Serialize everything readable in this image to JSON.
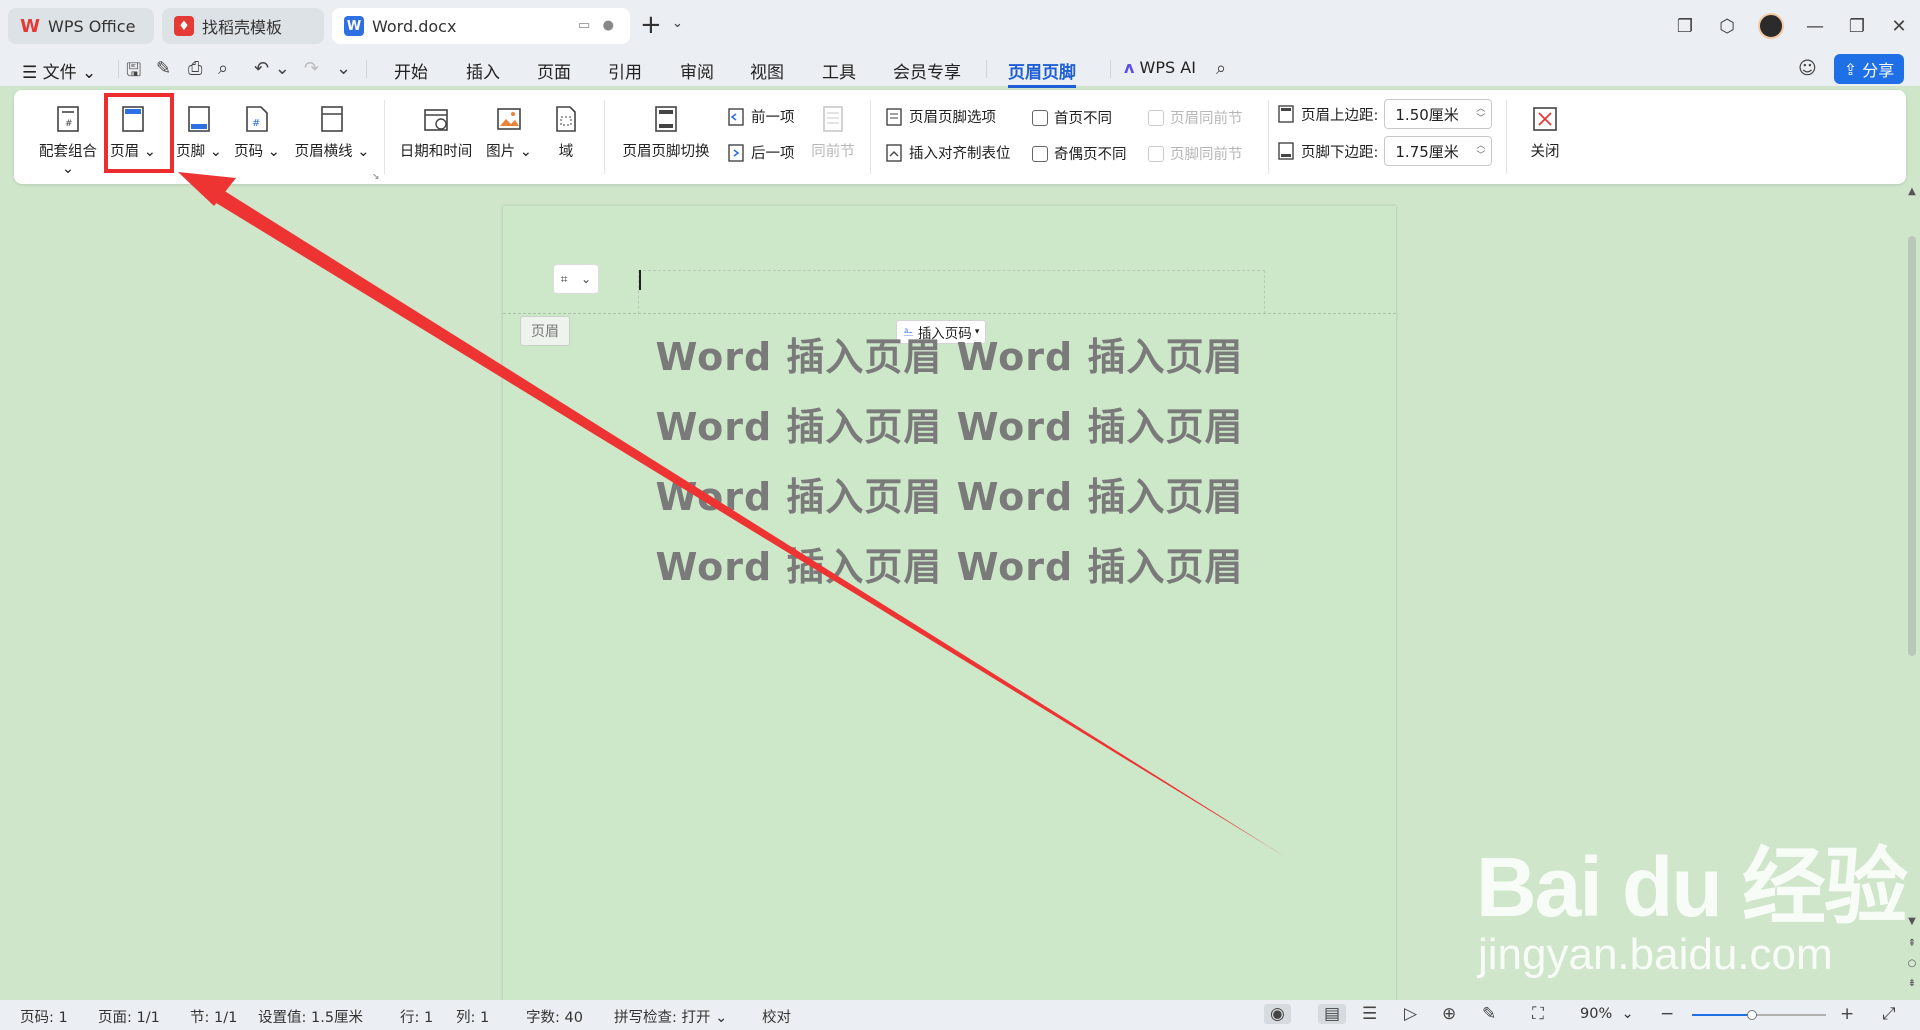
{
  "tabs": [
    {
      "label": "WPS Office",
      "active": false
    },
    {
      "label": "找稻壳模板",
      "active": false
    },
    {
      "label": "Word.docx",
      "active": true
    }
  ],
  "menu": {
    "file_label": "文件",
    "items": [
      "开始",
      "插入",
      "页面",
      "引用",
      "审阅",
      "视图",
      "工具",
      "会员专享",
      "页眉页脚"
    ],
    "active_item": "页眉页脚",
    "wps_ai": "WPS AI",
    "share": "分享"
  },
  "ribbon": {
    "group1": [
      "配套组合",
      "页眉",
      "页脚",
      "页码",
      "页眉横线"
    ],
    "group2": [
      "日期和时间",
      "图片",
      "域"
    ],
    "switch_label": "页眉页脚切换",
    "prev": "前一项",
    "next": "后一项",
    "same_as_prev": "同前节",
    "options": "页眉页脚选项",
    "insert_tab": "插入对齐制表位",
    "first_diff": "首页不同",
    "odd_even_diff": "奇偶页不同",
    "header_same_prev": "页眉同前节",
    "footer_same_prev": "页脚同前节",
    "header_top_label": "页眉上边距:",
    "header_top_value": "1.50厘米",
    "footer_bottom_label": "页脚下边距:",
    "footer_bottom_value": "1.75厘米",
    "close": "关闭"
  },
  "document": {
    "header_tag": "页眉",
    "insert_page_number": "插入页码",
    "lines": [
      "Word 插入页眉 Word 插入页眉",
      "Word 插入页眉 Word 插入页眉",
      "Word 插入页眉 Word 插入页眉",
      "Word 插入页眉 Word 插入页眉"
    ]
  },
  "status": {
    "page": "页码: 1",
    "pages": "页面: 1/1",
    "section": "节: 1/1",
    "setting": "设置值: 1.5厘米",
    "row": "行: 1",
    "col": "列: 1",
    "words": "字数: 40",
    "spell": "拼写检查: 打开",
    "proof": "校对",
    "zoom": "90%",
    "zoom_fraction": 0.45
  },
  "watermark": {
    "brand": "Bai du 经验",
    "url": "jingyan.baidu.com"
  },
  "colors": {
    "accent": "#1f5fd6",
    "highlight": "#ee2e2e",
    "page_bg": "#cde7c9"
  }
}
